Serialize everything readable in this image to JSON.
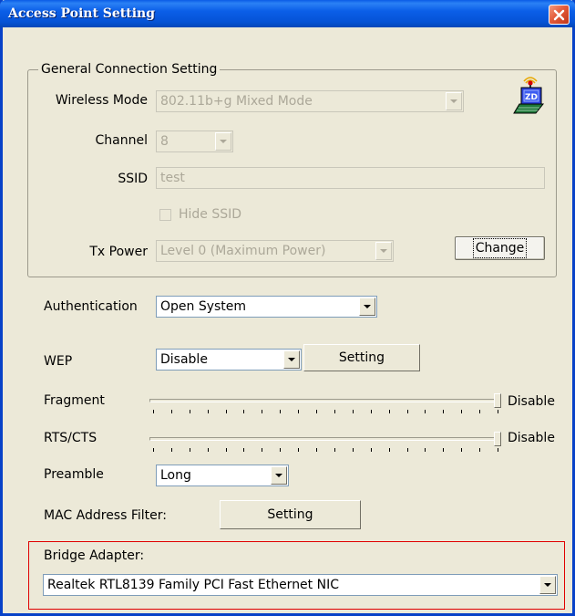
{
  "window": {
    "title": "Access Point Setting"
  },
  "general": {
    "legend": "General Connection Setting",
    "wireless_mode_label": "Wireless Mode",
    "wireless_mode_value": "802.11b+g Mixed Mode",
    "channel_label": "Channel",
    "channel_value": "8",
    "ssid_label": "SSID",
    "ssid_value": "test",
    "hide_ssid_label": "Hide SSID",
    "tx_power_label": "Tx Power",
    "tx_power_value": "Level 0 (Maximum Power)",
    "change_button": "Change",
    "icon": "wireless-access-point-icon",
    "icon_text": "ZD"
  },
  "security": {
    "authentication_label": "Authentication",
    "authentication_value": "Open System",
    "wep_label": "WEP",
    "wep_value": "Disable",
    "wep_setting_button": "Setting"
  },
  "advanced": {
    "fragment_label": "Fragment",
    "fragment_value_text": "Disable",
    "fragment_level": 1.0,
    "rts_label": "RTS/CTS",
    "rts_value_text": "Disable",
    "rts_level": 1.0,
    "preamble_label": "Preamble",
    "preamble_value": "Long",
    "mac_filter_label": "MAC Address Filter:",
    "mac_filter_button": "Setting"
  },
  "bridge": {
    "label": "Bridge Adapter:",
    "adapter_value": "Realtek RTL8139 Family PCI Fast Ethernet NIC"
  },
  "colors": {
    "titlebar": "#0553d6",
    "dialog_bg": "#ece9d8",
    "highlight_border": "#e00000"
  }
}
